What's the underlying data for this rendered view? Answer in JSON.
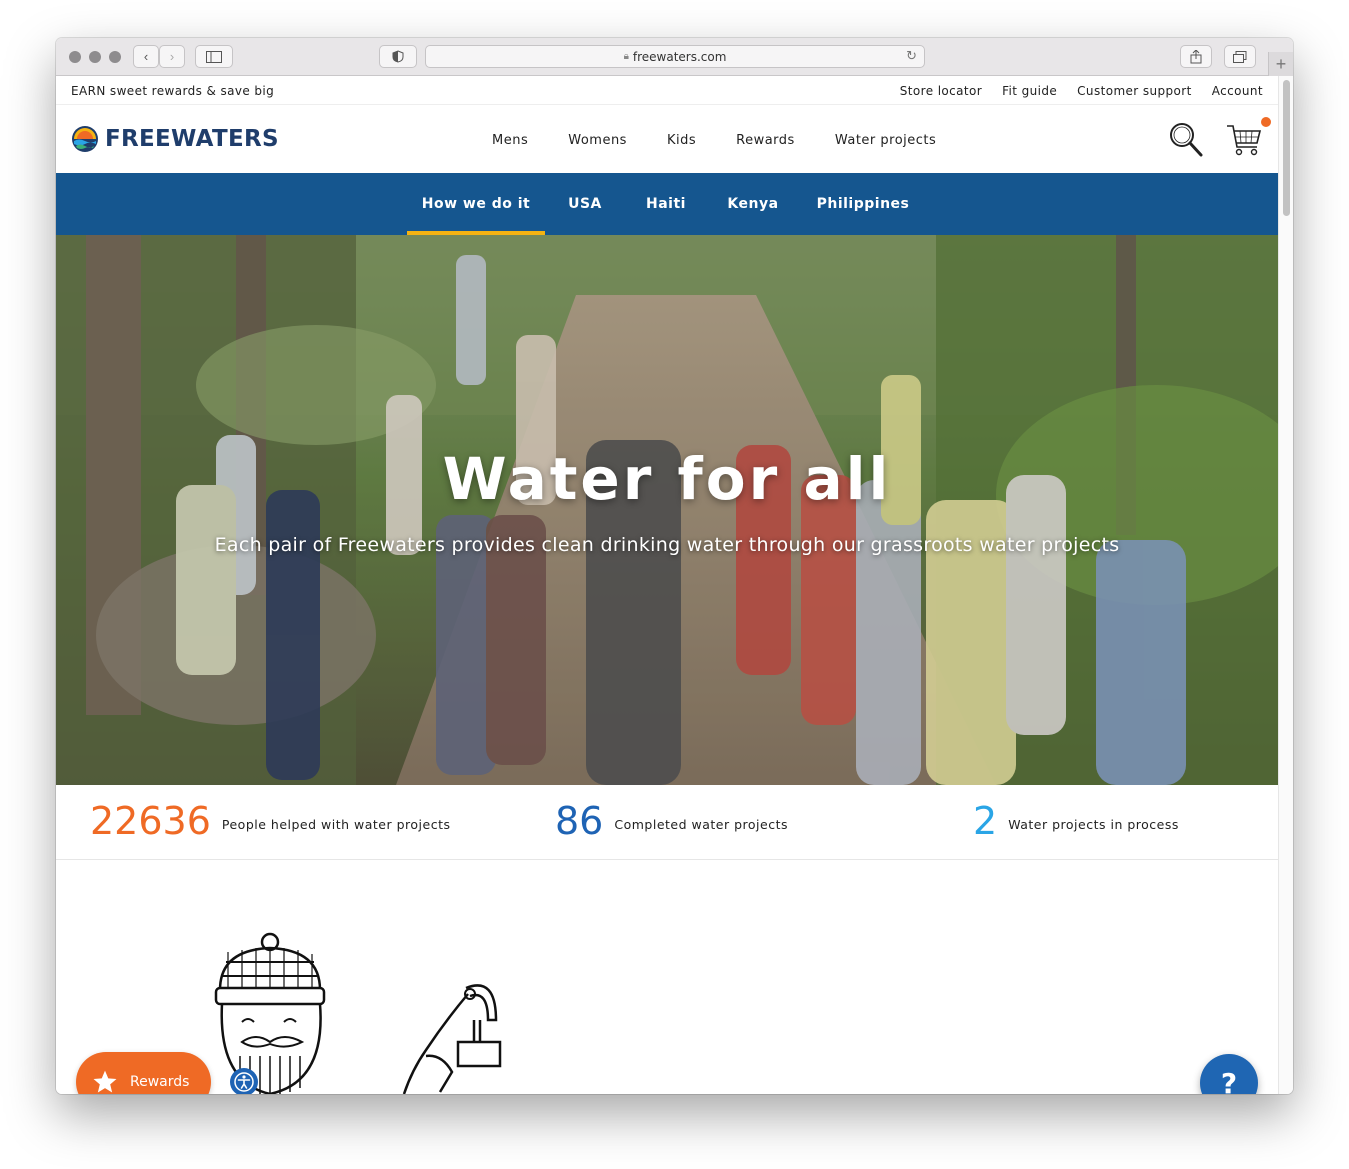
{
  "browser": {
    "url": "freewaters.com"
  },
  "promo": {
    "text": "EARN sweet rewards & save big",
    "links": [
      "Store locator",
      "Fit guide",
      "Customer support",
      "Account"
    ]
  },
  "logo": {
    "text": "FREEWATERS"
  },
  "nav": {
    "items": [
      "Mens",
      "Womens",
      "Kids",
      "Rewards",
      "Water projects"
    ],
    "icons": [
      "search-icon",
      "cart-icon"
    ]
  },
  "subnav": {
    "items": [
      "How we do it",
      "USA",
      "Haiti",
      "Kenya",
      "Philippines"
    ],
    "active": "How we do it"
  },
  "hero": {
    "title": "Water for all",
    "subtitle": "Each pair of Freewaters provides clean drinking water through our grassroots water projects"
  },
  "stats": [
    {
      "value": "22636",
      "label": "People helped with water projects",
      "color": "#ef6a25"
    },
    {
      "value": "86",
      "label": "Completed water projects",
      "color": "#1e63b4"
    },
    {
      "value": "2",
      "label": "Water projects in process",
      "color": "#2aa5e6"
    }
  ],
  "widgets": {
    "rewards_label": "Rewards",
    "help_label": "?"
  },
  "colors": {
    "brand_navy": "#1f3d6b",
    "subnav_blue": "#15568f",
    "active_underline": "#f4b313",
    "accent_orange": "#ef6a25"
  }
}
